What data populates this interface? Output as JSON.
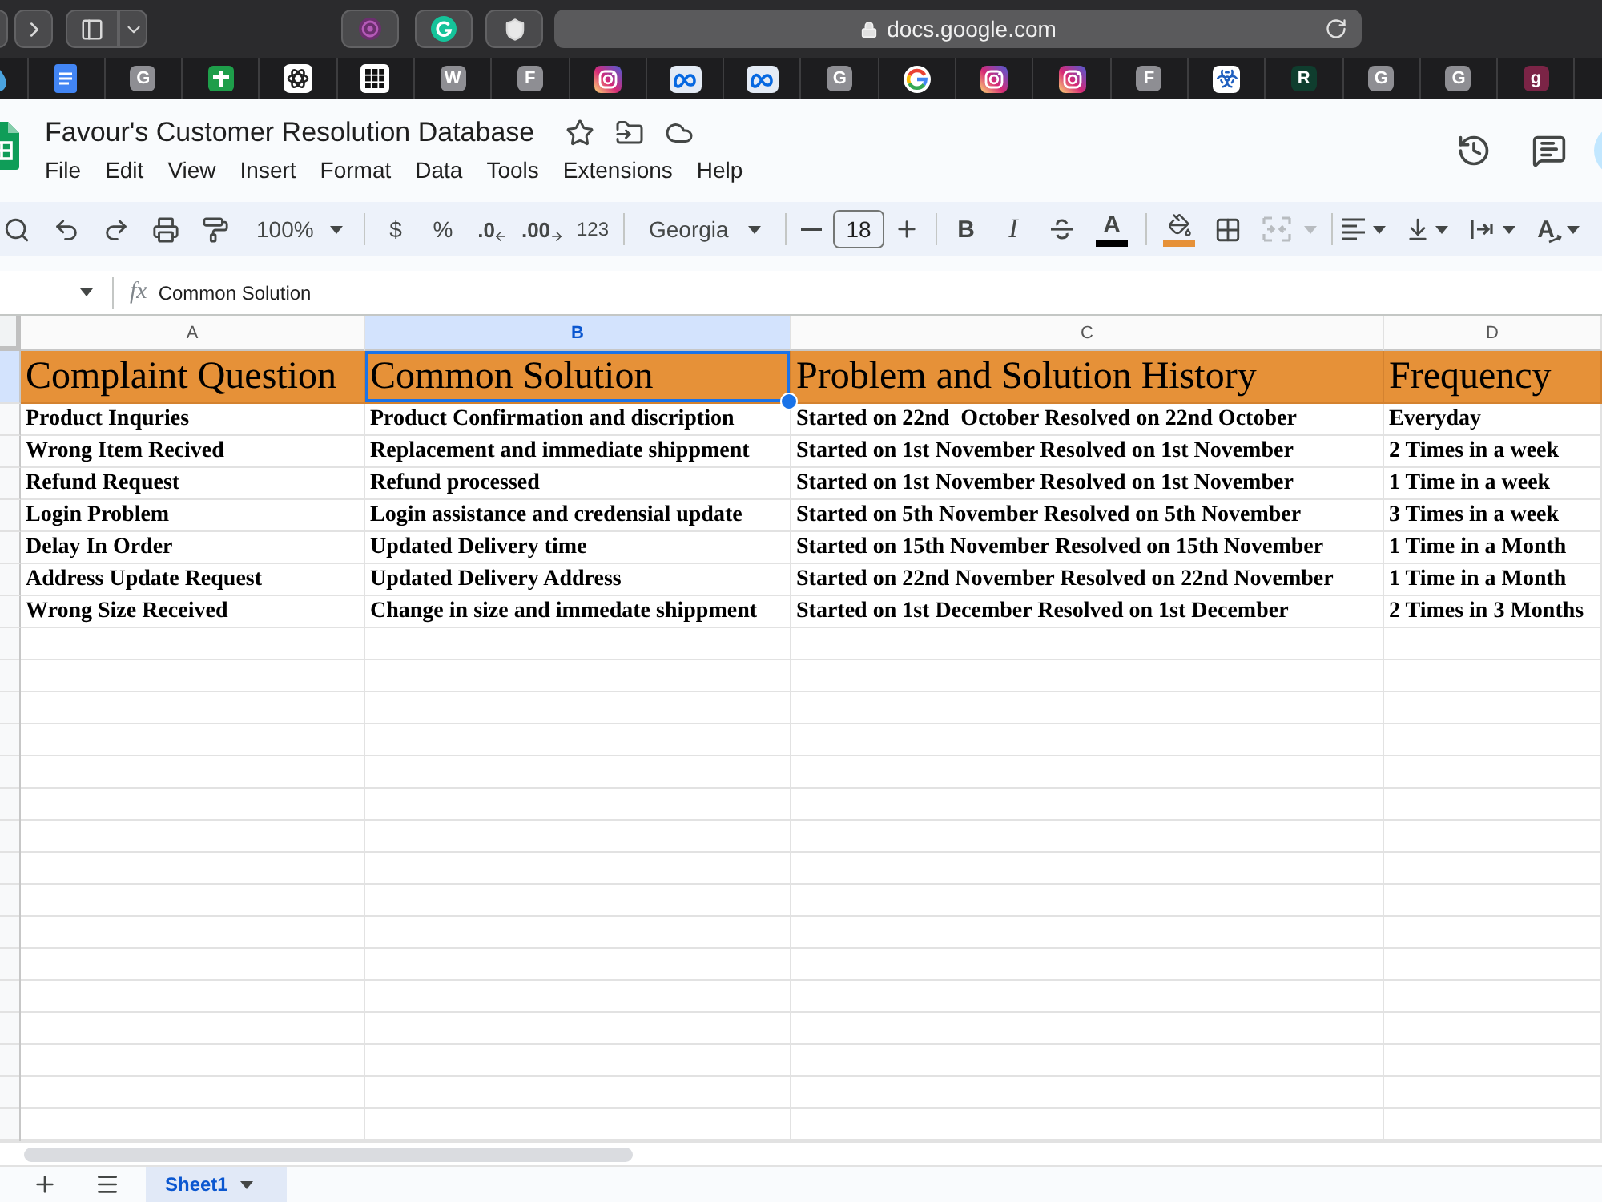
{
  "browser": {
    "url": "docs.google.com",
    "bookmarks": [
      {
        "kind": "drop"
      },
      {
        "kind": "docs"
      },
      {
        "kind": "letter",
        "text": "G",
        "color": "#8e8e93"
      },
      {
        "kind": "sheets"
      },
      {
        "kind": "chatgpt"
      },
      {
        "kind": "grid"
      },
      {
        "kind": "letter",
        "text": "W",
        "color": "#8e8e93"
      },
      {
        "kind": "letter",
        "text": "F",
        "color": "#8e8e93"
      },
      {
        "kind": "instagram"
      },
      {
        "kind": "meta"
      },
      {
        "kind": "meta"
      },
      {
        "kind": "letter",
        "text": "G",
        "color": "#8e8e93"
      },
      {
        "kind": "google"
      },
      {
        "kind": "instagram"
      },
      {
        "kind": "instagram"
      },
      {
        "kind": "letter",
        "text": "F",
        "color": "#8e8e93"
      },
      {
        "kind": "biohazard"
      },
      {
        "kind": "letter",
        "text": "R",
        "color": "#0f3d2e"
      },
      {
        "kind": "letter",
        "text": "G",
        "color": "#8e8e93"
      },
      {
        "kind": "letter",
        "text": "G",
        "color": "#8e8e93"
      },
      {
        "kind": "letter",
        "text": "g",
        "color": "#7b2446"
      }
    ]
  },
  "document": {
    "title": "Favour's Customer Resolution Database",
    "menu": [
      "File",
      "Edit",
      "View",
      "Insert",
      "Format",
      "Data",
      "Tools",
      "Extensions",
      "Help"
    ]
  },
  "toolbar": {
    "zoom": "100%",
    "currency": "$",
    "percent": "%",
    "decrease_decimals": ".0",
    "increase_decimals": ".00",
    "number_format": "123",
    "font": "Georgia",
    "font_size": "18",
    "bold": "B",
    "italic": "I",
    "text_color": "A",
    "merge_disabled": true,
    "text_rotation": "A"
  },
  "formula_bar": {
    "label": "fx",
    "value": "Common Solution"
  },
  "grid": {
    "columns": [
      {
        "label": "A",
        "selected": false
      },
      {
        "label": "B",
        "selected": true
      },
      {
        "label": "C",
        "selected": false
      },
      {
        "label": "D",
        "selected": false
      }
    ],
    "rows": [
      {
        "kind": "header",
        "selected": true,
        "cells": [
          {
            "text": "Complaint Question",
            "selected": false
          },
          {
            "text": "Common Solution",
            "selected": true
          },
          {
            "text": "Problem and Solution History",
            "selected": false
          },
          {
            "text": "Frequency",
            "selected": false
          }
        ]
      },
      {
        "kind": "data",
        "selected": false,
        "cells": [
          {
            "text": "Product Inquries",
            "selected": false
          },
          {
            "text": "Product Confirmation and discription",
            "selected": false
          },
          {
            "text": "Started on 22nd  October Resolved on 22nd October",
            "selected": false
          },
          {
            "text": "Everyday",
            "selected": false
          }
        ]
      },
      {
        "kind": "data",
        "selected": false,
        "cells": [
          {
            "text": "Wrong Item Recived",
            "selected": false
          },
          {
            "text": "Replacement and immediate shippment",
            "selected": false
          },
          {
            "text": "Started on 1st November Resolved on 1st November",
            "selected": false
          },
          {
            "text": "2 Times in a week",
            "selected": false
          }
        ]
      },
      {
        "kind": "data",
        "selected": false,
        "cells": [
          {
            "text": "Refund Request",
            "selected": false
          },
          {
            "text": "Refund processed",
            "selected": false
          },
          {
            "text": "Started on 1st November Resolved on 1st November",
            "selected": false
          },
          {
            "text": "1 Time in a week",
            "selected": false
          }
        ]
      },
      {
        "kind": "data",
        "selected": false,
        "cells": [
          {
            "text": "Login Problem",
            "selected": false
          },
          {
            "text": "Login assistance and credensial update",
            "selected": false
          },
          {
            "text": "Started on 5th November Resolved on 5th November",
            "selected": false
          },
          {
            "text": "3 Times in a week",
            "selected": false
          }
        ]
      },
      {
        "kind": "data",
        "selected": false,
        "cells": [
          {
            "text": "Delay In Order",
            "selected": false
          },
          {
            "text": "Updated Delivery time",
            "selected": false
          },
          {
            "text": "Started on 15th November Resolved on 15th November",
            "selected": false
          },
          {
            "text": "1 Time in a Month",
            "selected": false
          }
        ]
      },
      {
        "kind": "data",
        "selected": false,
        "cells": [
          {
            "text": "Address Update Request",
            "selected": false
          },
          {
            "text": "Updated Delivery Address",
            "selected": false
          },
          {
            "text": "Started on 22nd November Resolved on 22nd November",
            "selected": false
          },
          {
            "text": "1 Time in a Month",
            "selected": false
          }
        ]
      },
      {
        "kind": "data",
        "selected": false,
        "cells": [
          {
            "text": "Wrong Size Received",
            "selected": false
          },
          {
            "text": "Change in size and immedate shippment",
            "selected": false
          },
          {
            "text": "Started on 1st December Resolved on 1st December",
            "selected": false
          },
          {
            "text": "2 Times in 3 Months",
            "selected": false
          }
        ]
      }
    ]
  },
  "sheet_tabs": [
    {
      "label": "Sheet1",
      "selected": true
    }
  ]
}
